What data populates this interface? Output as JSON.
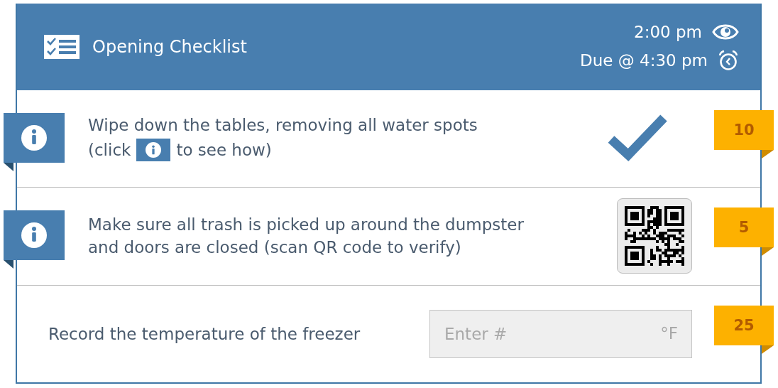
{
  "header": {
    "title": "Opening Checklist",
    "time": "2:00 pm",
    "due": "Due @ 4:30 pm"
  },
  "rows": [
    {
      "kind": "check",
      "info_button": true,
      "lines": [
        "Wipe down the tables, removing all water spots"
      ],
      "hint_before": "(click",
      "hint_after": "to see how)",
      "done": true,
      "points": "10"
    },
    {
      "kind": "qr",
      "info_button": true,
      "lines": [
        "Make sure all trash is picked up around the dumpster",
        "and doors are closed (scan QR code to verify)"
      ],
      "points": "5"
    },
    {
      "kind": "input",
      "info_button": false,
      "lines": [
        "Record the temperature of the freezer"
      ],
      "placeholder": "Enter #",
      "unit": "°F",
      "points": "25"
    }
  ]
}
